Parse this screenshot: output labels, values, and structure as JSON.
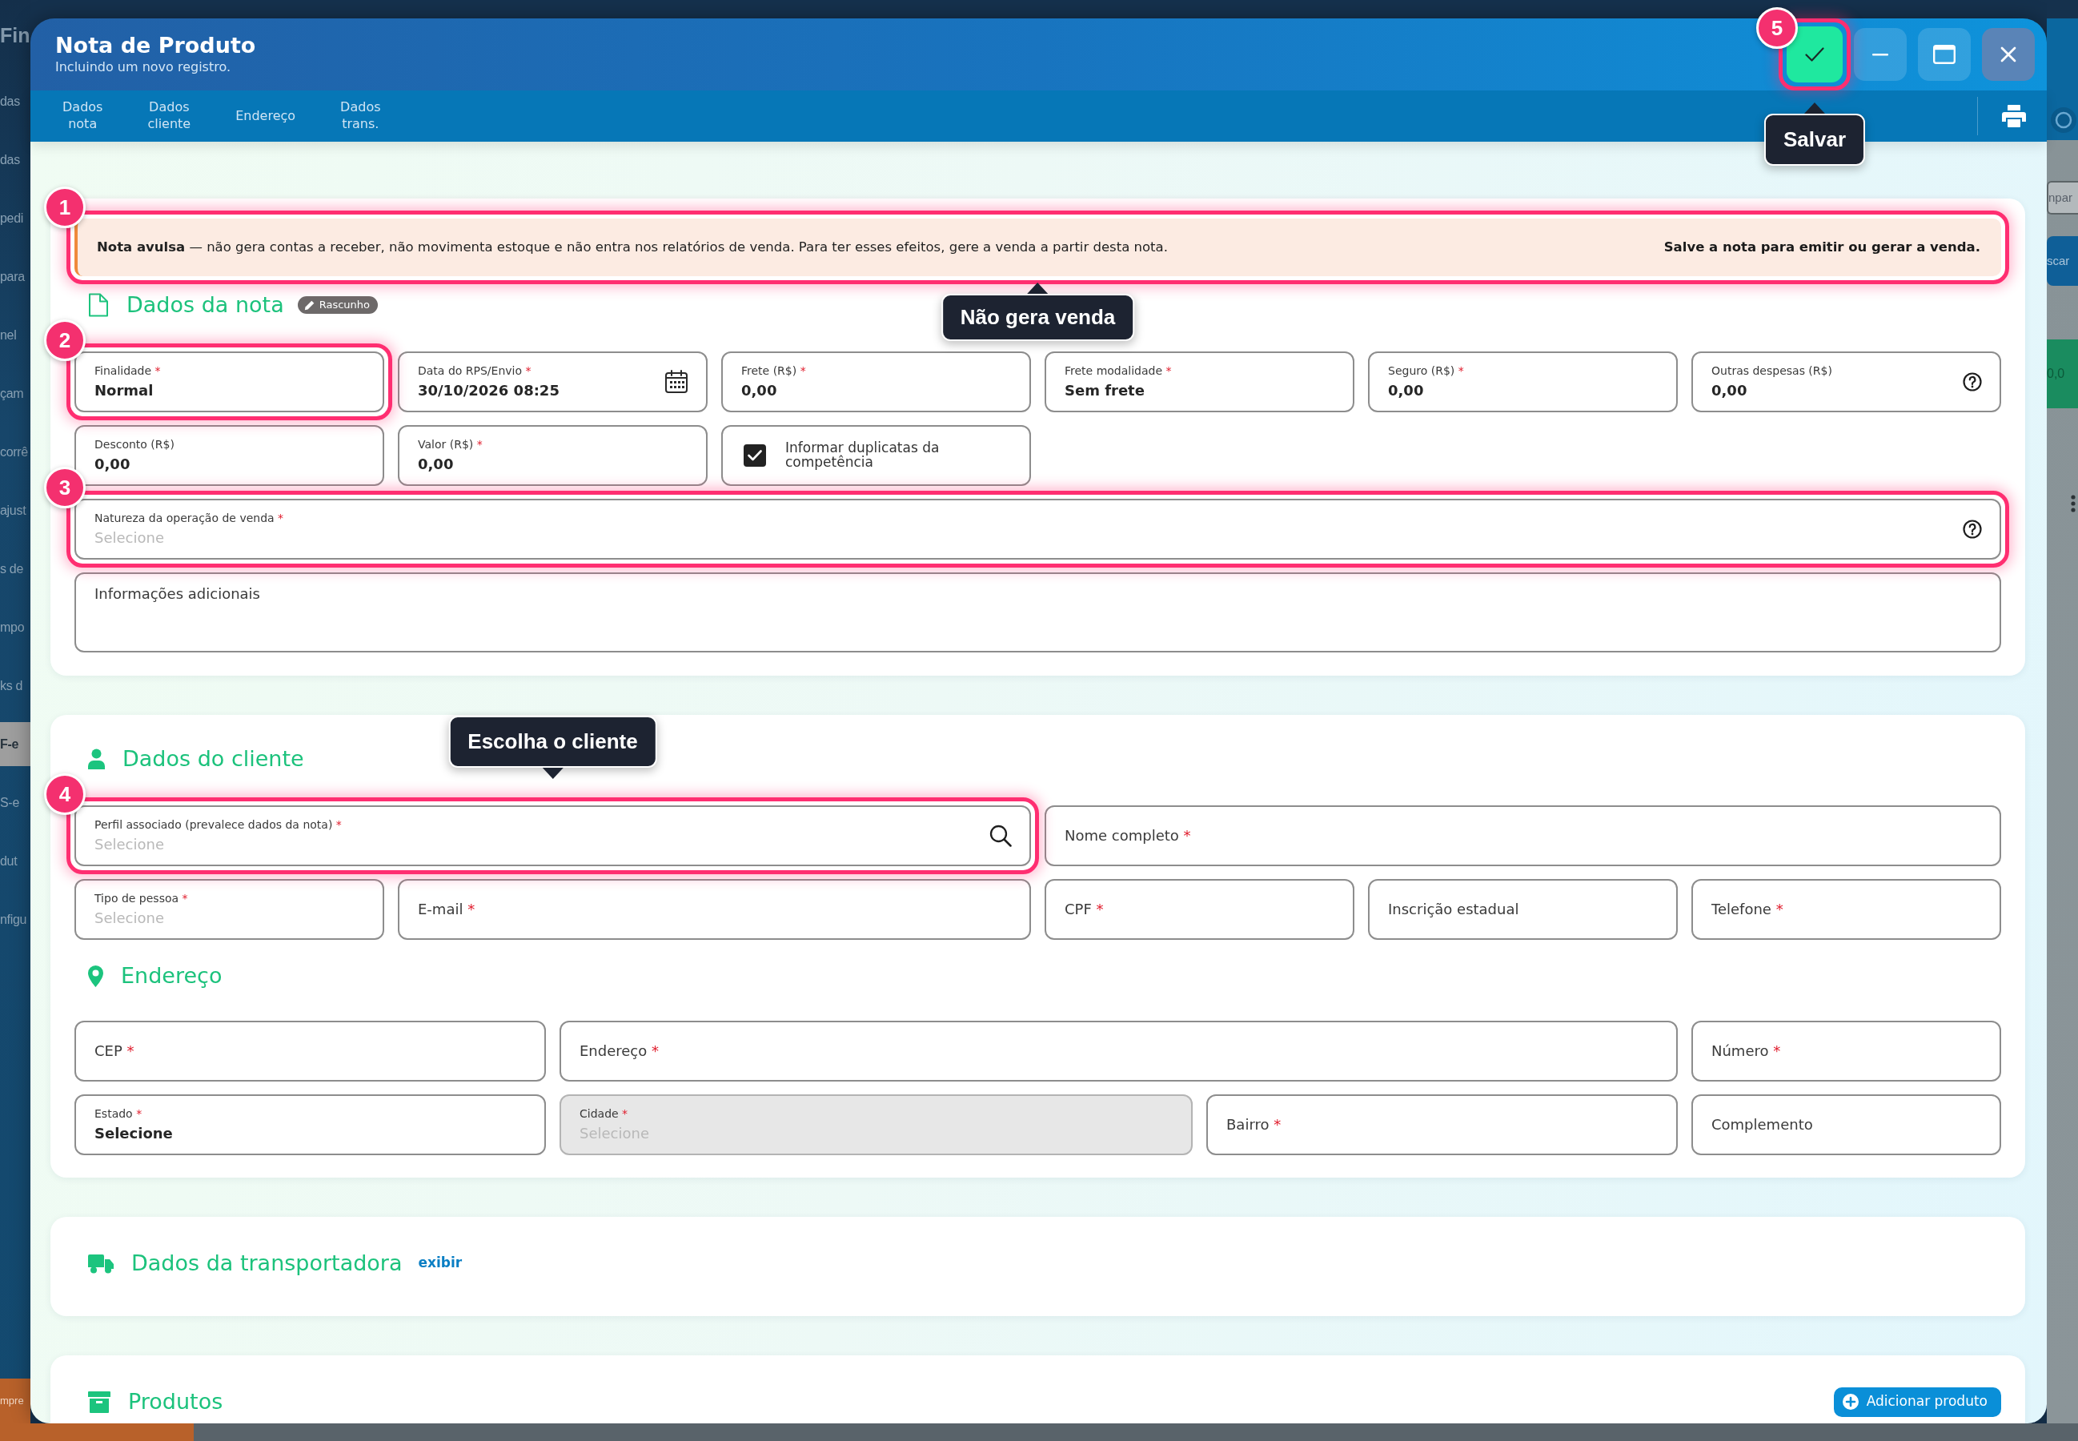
{
  "window": {
    "title": "Nota de Produto",
    "subtitle": "Incluindo um novo registro.",
    "actions": [
      {
        "kind": "save",
        "step": "5",
        "tooltip": "Salvar"
      },
      {
        "kind": "minimize"
      },
      {
        "kind": "maximize"
      },
      {
        "kind": "close"
      }
    ]
  },
  "tabs": [
    {
      "label": "Dados nota",
      "selected": false
    },
    {
      "label": "Dados cliente",
      "selected": false
    },
    {
      "label": "Endereço",
      "selected": false
    },
    {
      "label": "Dados trans.",
      "selected": false
    }
  ],
  "tab_bar_actions": [
    {
      "kind": "print"
    }
  ],
  "sections": [
    {
      "kind": "nota",
      "title": "Dados da nota",
      "badge": "Rascunho",
      "alert": {
        "text": "**Nota avulsa** — não gera contas a receber, não movimenta estoque e não entra nos relatórios de venda. Para ter esses efeitos, gere a venda a partir desta nota.",
        "note": "Salve a nota para emitir ou gerar a venda.",
        "step": "1",
        "tooltip": "Não gera venda"
      },
      "fields": [
        {
          "kind": "input",
          "label": "Finalidade",
          "marker": "*",
          "value": "Normal",
          "disabled": false,
          "step": "2"
        },
        {
          "kind": "date",
          "label": "Data do RPS/Envio",
          "marker": "*",
          "value": "30/10/2026 08:25",
          "disabled": false
        },
        {
          "kind": "input",
          "label": "Frete (R$)",
          "marker": "*",
          "value": "0,00",
          "disabled": false
        },
        {
          "kind": "input",
          "label": "Frete modalidade",
          "marker": "*",
          "value": "Sem frete",
          "disabled": false
        },
        {
          "kind": "input",
          "label": "Seguro (R$)",
          "marker": "*",
          "value": "0,00",
          "disabled": false
        },
        {
          "kind": "input",
          "label": "Outras despesas (R$)",
          "value": "0,00",
          "help": true,
          "disabled": false
        },
        {
          "kind": "input",
          "label": "Desconto (R$)",
          "value": "0,00",
          "disabled": false
        },
        {
          "kind": "input",
          "label": "Valor (R$)",
          "marker": "*",
          "value": "0,00",
          "disabled": false
        },
        {
          "kind": "checkbox",
          "label": "Informar duplicatas da competência",
          "checked": true,
          "disabled": false
        },
        {
          "kind": "input",
          "label": "Natureza da operação de venda",
          "marker": "*",
          "placeholder": "Selecione",
          "help": true,
          "disabled": false,
          "step": "3"
        },
        {
          "kind": "textarea",
          "label": "Informações adicionais",
          "disabled": false
        }
      ]
    },
    {
      "kind": "cliente",
      "title": "Dados do cliente",
      "fields": [
        {
          "kind": "search",
          "label": "Perfil associado (prevalece dados da nota)",
          "marker": "*",
          "placeholder": "Selecione",
          "disabled": false,
          "step": "4",
          "tooltip": "Escolha o cliente"
        },
        {
          "kind": "input",
          "label": "Nome completo",
          "marker": "*",
          "disabled": false
        },
        {
          "kind": "input",
          "label": "Tipo de pessoa",
          "marker": "*",
          "placeholder": "Selecione",
          "disabled": false
        },
        {
          "kind": "input",
          "label": "E-mail",
          "marker": "*",
          "disabled": false
        },
        {
          "kind": "input",
          "label": "CPF",
          "marker": "*",
          "disabled": false
        },
        {
          "kind": "input",
          "label": "Inscrição estadual",
          "disabled": false
        },
        {
          "kind": "input",
          "label": "Telefone",
          "marker": "*",
          "disabled": false
        }
      ],
      "subsections": [
        {
          "kind": "endereco",
          "title": "Endereço",
          "fields": [
            {
              "kind": "input",
              "label": "CEP",
              "marker": "*",
              "disabled": false
            },
            {
              "kind": "input",
              "label": "Endereço",
              "marker": "*",
              "disabled": false
            },
            {
              "kind": "input",
              "label": "Número",
              "marker": "*",
              "disabled": false
            },
            {
              "kind": "input",
              "label": "Estado",
              "marker": "*",
              "value": "Selecione",
              "disabled": false
            },
            {
              "kind": "input",
              "label": "Cidade",
              "marker": "*",
              "placeholder": "Selecione",
              "disabled": true
            },
            {
              "kind": "input",
              "label": "Bairro",
              "marker": "*",
              "disabled": false
            },
            {
              "kind": "input",
              "label": "Complemento",
              "disabled": false
            }
          ]
        }
      ]
    },
    {
      "kind": "transportadora",
      "title": "Dados da transportadora",
      "link": "exibir"
    },
    {
      "kind": "produtos",
      "title": "Produtos",
      "button": "Adicionar produto"
    }
  ],
  "backdrop": {
    "header_fragment": "Fin",
    "sidebar": [
      {
        "text": "das",
        "selected": false
      },
      {
        "text": "das",
        "selected": false
      },
      {
        "text": "pedi",
        "selected": false
      },
      {
        "text": "para",
        "selected": false
      },
      {
        "text": "nel",
        "selected": false
      },
      {
        "text": "çam",
        "selected": false
      },
      {
        "text": "corrê",
        "selected": false
      },
      {
        "text": "ajust",
        "selected": false
      },
      {
        "text": "s de",
        "selected": false
      },
      {
        "text": "mpo",
        "selected": false
      },
      {
        "text": "ks d",
        "selected": false
      },
      {
        "text": "F-e",
        "selected": true
      },
      {
        "text": "S-e",
        "selected": false
      },
      {
        "text": "dut",
        "selected": false
      },
      {
        "text": "nfigu",
        "selected": false
      }
    ],
    "footer_fragment": "mpre",
    "side_items": [
      {
        "kind": "icon"
      },
      {
        "kind": "field",
        "text": "npar"
      },
      {
        "kind": "button",
        "text": "scar"
      },
      {
        "kind": "total",
        "text": "0,0"
      },
      {
        "kind": "menu"
      }
    ]
  }
}
